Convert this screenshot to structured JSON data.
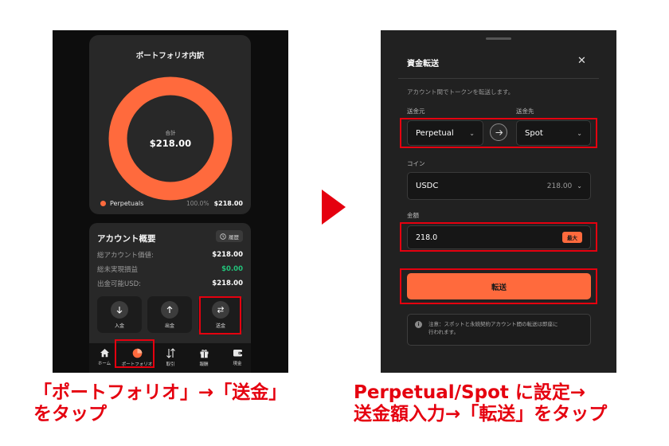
{
  "left_screen": {
    "portfolio_title": "ポートフォリオ内訳",
    "donut_label": "合計",
    "donut_value": "$218.00",
    "legend": {
      "name": "Perpetuals",
      "percent": "100.0%",
      "amount": "$218.00",
      "color": "#ff6a3d"
    },
    "account": {
      "title": "アカウント概要",
      "history_label": "履歴",
      "rows": [
        {
          "label": "総アカウント価値:",
          "value": "$218.00"
        },
        {
          "label": "総未実現損益",
          "value": "$0.00"
        },
        {
          "label": "出金可能USD:",
          "value": "$218.00"
        }
      ],
      "actions": [
        {
          "label": "入金",
          "icon": "arrow-down-icon"
        },
        {
          "label": "出金",
          "icon": "arrow-up-icon"
        },
        {
          "label": "送金",
          "icon": "swap-icon"
        }
      ]
    },
    "tabs": [
      {
        "label": "ホーム",
        "icon": "home-icon"
      },
      {
        "label": "ポートフォリオ",
        "icon": "pie-chart-icon"
      },
      {
        "label": "取引",
        "icon": "trade-icon"
      },
      {
        "label": "報酬",
        "icon": "gift-icon"
      },
      {
        "label": "現金",
        "icon": "wallet-icon"
      }
    ]
  },
  "right_screen": {
    "title": "資金転送",
    "close_icon": "close-icon",
    "description": "アカウント間でトークンを転送します。",
    "from_label": "送金元",
    "from_value": "Perpetual",
    "to_label": "送金先",
    "to_value": "Spot",
    "coin_label": "コイン",
    "coin_value": "USDC",
    "coin_balance": "218.00",
    "amount_label": "金額",
    "amount_value": "218.0",
    "max_label": "最大",
    "submit_label": "転送",
    "note_line1": "注意：スポットと永続契約アカウント間の転送は即座に",
    "note_line2": "行われます。"
  },
  "captions": {
    "left_line1": "「ポートフォリオ」→「送金」",
    "left_line2": "をタップ",
    "right_line1": "Perpetual/Spot に設定→",
    "right_line2": "送金額入力→「転送」をタップ"
  },
  "colors": {
    "accent": "#ff6a3d",
    "highlight": "#e5000f",
    "positive": "#22c37a"
  }
}
